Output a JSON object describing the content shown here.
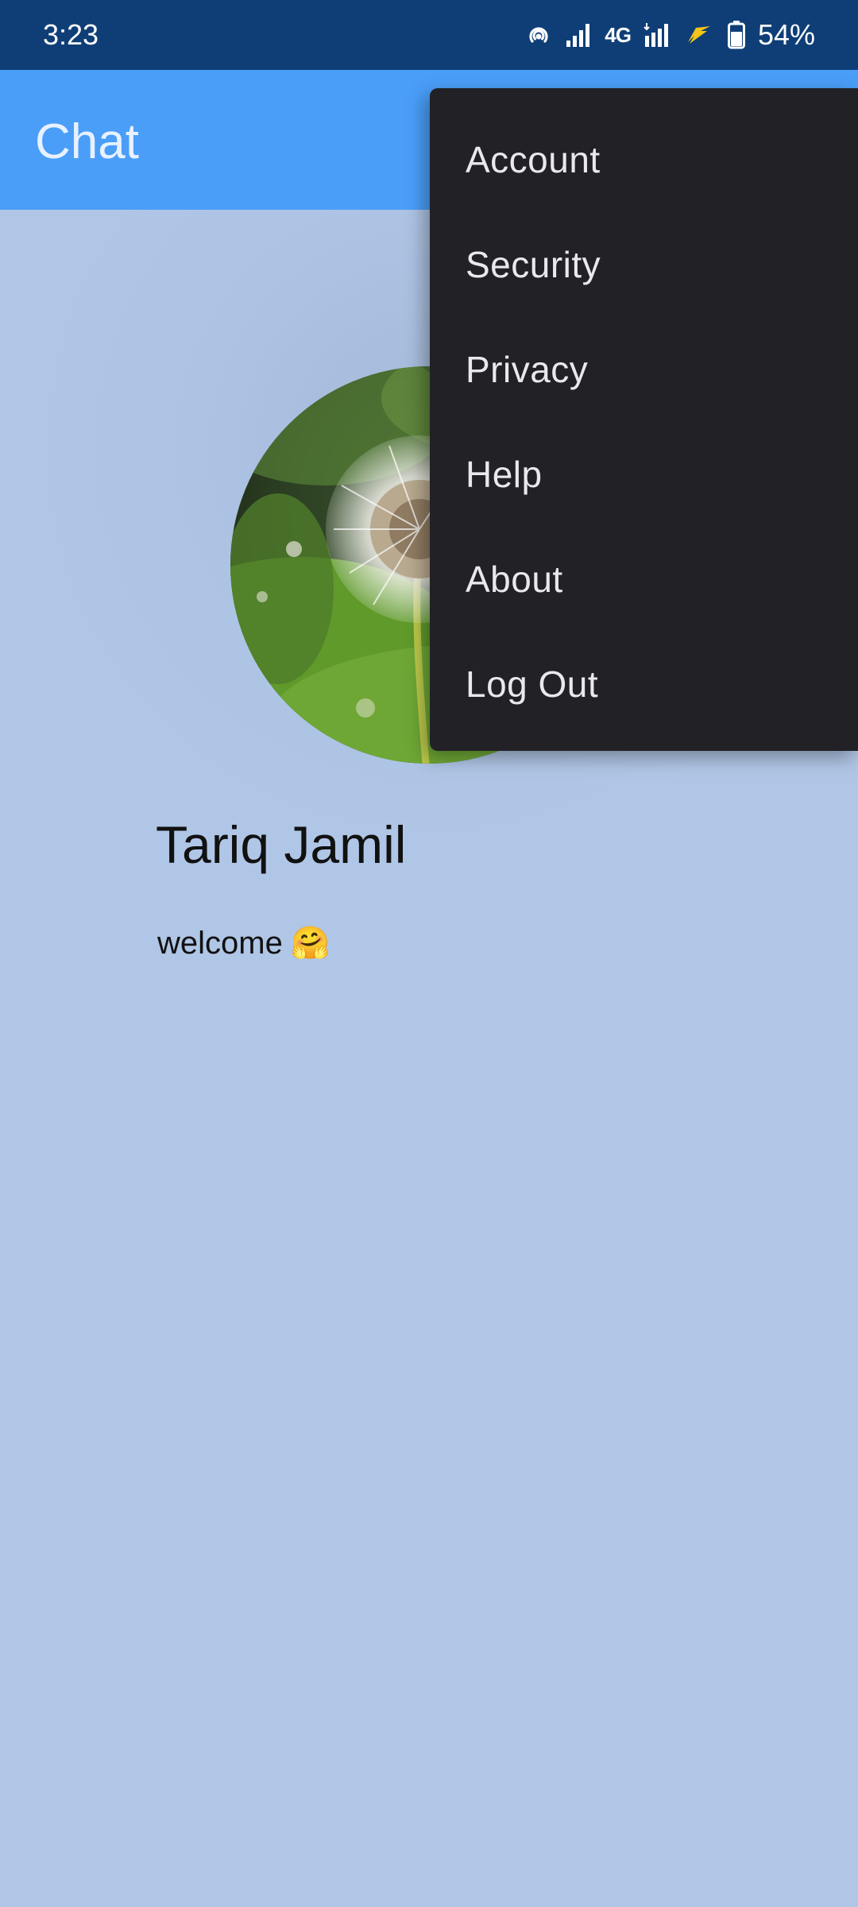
{
  "status_bar": {
    "time": "3:23",
    "network_type": "4G",
    "battery_percent": "54%",
    "icons": [
      "hotspot-icon",
      "signal-icon",
      "signal-icon-2",
      "charging-icon",
      "battery-icon"
    ]
  },
  "app_bar": {
    "title": "Chat"
  },
  "profile": {
    "name": "Tariq Jamil",
    "status": "welcome",
    "status_emoji": "🤗",
    "avatar_icon": "dandelion-photo"
  },
  "menu": {
    "items": [
      {
        "label": "Account"
      },
      {
        "label": "Security"
      },
      {
        "label": "Privacy"
      },
      {
        "label": "Help"
      },
      {
        "label": "About"
      },
      {
        "label": "Log Out"
      }
    ]
  },
  "colors": {
    "status_bar": "#0f3e77",
    "app_bar": "#4a9ef8",
    "background": "#b0c6e6",
    "menu_bg": "#222126",
    "menu_text": "#e9e8ee"
  }
}
